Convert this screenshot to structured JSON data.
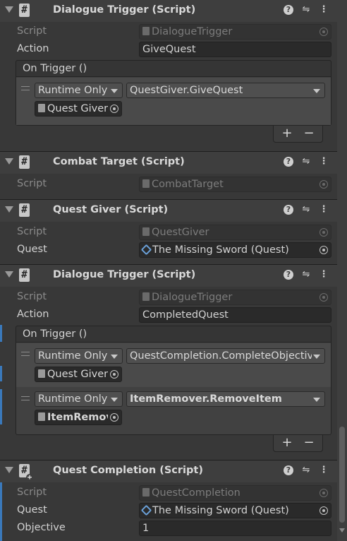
{
  "components": [
    {
      "title": "Dialogue Trigger (Script)",
      "script_label": "Script",
      "script_value": "DialogueTrigger",
      "action_label": "Action",
      "action_value": "GiveQuest",
      "event_header": "On Trigger ()",
      "listeners": [
        {
          "mode": "Runtime Only",
          "function": "QuestGiver.GiveQuest",
          "target": "Quest Giver"
        }
      ]
    },
    {
      "title": "Combat Target (Script)",
      "script_label": "Script",
      "script_value": "CombatTarget"
    },
    {
      "title": "Quest Giver (Script)",
      "script_label": "Script",
      "script_value": "QuestGiver",
      "quest_label": "Quest",
      "quest_value": "The Missing Sword (Quest)"
    },
    {
      "title": "Dialogue Trigger (Script)",
      "script_label": "Script",
      "script_value": "DialogueTrigger",
      "action_label": "Action",
      "action_value": "CompletedQuest",
      "event_header": "On Trigger ()",
      "listeners": [
        {
          "mode": "Runtime Only",
          "function": "QuestCompletion.CompleteObjective",
          "target": "Quest Giver"
        },
        {
          "mode": "Runtime Only",
          "function": "ItemRemover.RemoveItem",
          "target": "ItemRemover"
        }
      ]
    },
    {
      "title": "Quest Completion (Script)",
      "script_label": "Script",
      "script_value": "QuestCompletion",
      "quest_label": "Quest",
      "quest_value": "The Missing Sword (Quest)",
      "objective_label": "Objective",
      "objective_value": "1"
    }
  ],
  "buttons": {
    "add": "+",
    "remove": "−"
  },
  "icons": {
    "help": "?",
    "preset": "⇋",
    "more": "⋮",
    "script": "#"
  },
  "colors": {
    "selection": "#3a79bb",
    "background": "#383838",
    "header": "#3e3e3e"
  }
}
